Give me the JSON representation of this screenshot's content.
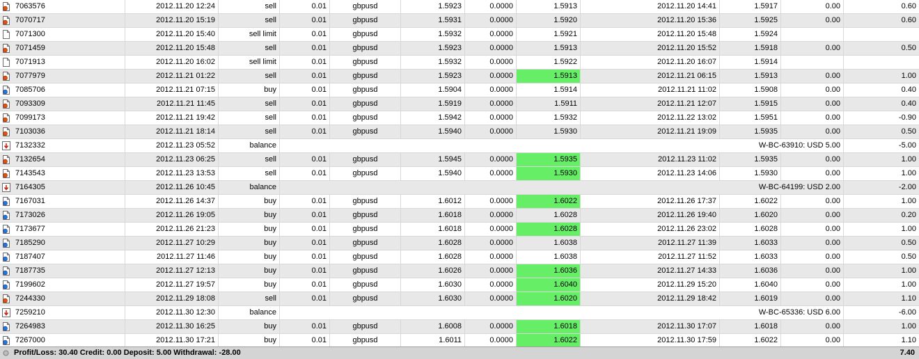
{
  "colors": {
    "highlight": "#66ee66",
    "sell_icon": "#e05010",
    "buy_icon": "#2a72d8",
    "balance_icon": "#c0281a"
  },
  "rows": [
    {
      "ticket": "7063576",
      "open_time": "2012.11.20 12:24",
      "type": "sell",
      "size": "0.01",
      "item": "gbpusd",
      "price": "1.5923",
      "sl": "0.0000",
      "tp": "1.5913",
      "close_time": "2012.11.20 14:41",
      "close_price": "1.5917",
      "swap": "0.00",
      "profit": "0.60",
      "kind": "sell",
      "hl": false
    },
    {
      "ticket": "7070717",
      "open_time": "2012.11.20 15:19",
      "type": "sell",
      "size": "0.01",
      "item": "gbpusd",
      "price": "1.5931",
      "sl": "0.0000",
      "tp": "1.5920",
      "close_time": "2012.11.20 15:36",
      "close_price": "1.5925",
      "swap": "0.00",
      "profit": "0.60",
      "kind": "sell",
      "hl": false
    },
    {
      "ticket": "7071300",
      "open_time": "2012.11.20 15:40",
      "type": "sell limit",
      "size": "0.01",
      "item": "gbpusd",
      "price": "1.5932",
      "sl": "0.0000",
      "tp": "1.5921",
      "close_time": "2012.11.20 15:48",
      "close_price": "1.5924",
      "swap": "",
      "profit": "",
      "kind": "doc",
      "hl": false
    },
    {
      "ticket": "7071459",
      "open_time": "2012.11.20 15:48",
      "type": "sell",
      "size": "0.01",
      "item": "gbpusd",
      "price": "1.5923",
      "sl": "0.0000",
      "tp": "1.5913",
      "close_time": "2012.11.20 15:52",
      "close_price": "1.5918",
      "swap": "0.00",
      "profit": "0.50",
      "kind": "sell",
      "hl": false
    },
    {
      "ticket": "7071913",
      "open_time": "2012.11.20 16:02",
      "type": "sell limit",
      "size": "0.01",
      "item": "gbpusd",
      "price": "1.5932",
      "sl": "0.0000",
      "tp": "1.5922",
      "close_time": "2012.11.20 16:07",
      "close_price": "1.5914",
      "swap": "",
      "profit": "",
      "kind": "doc",
      "hl": false
    },
    {
      "ticket": "7077979",
      "open_time": "2012.11.21 01:22",
      "type": "sell",
      "size": "0.01",
      "item": "gbpusd",
      "price": "1.5923",
      "sl": "0.0000",
      "tp": "1.5913",
      "close_time": "2012.11.21 06:15",
      "close_price": "1.5913",
      "swap": "0.00",
      "profit": "1.00",
      "kind": "sell",
      "hl": true
    },
    {
      "ticket": "7085706",
      "open_time": "2012.11.21 07:15",
      "type": "buy",
      "size": "0.01",
      "item": "gbpusd",
      "price": "1.5904",
      "sl": "0.0000",
      "tp": "1.5914",
      "close_time": "2012.11.21 11:02",
      "close_price": "1.5908",
      "swap": "0.00",
      "profit": "0.40",
      "kind": "buy",
      "hl": false
    },
    {
      "ticket": "7093309",
      "open_time": "2012.11.21 11:45",
      "type": "sell",
      "size": "0.01",
      "item": "gbpusd",
      "price": "1.5919",
      "sl": "0.0000",
      "tp": "1.5911",
      "close_time": "2012.11.21 12:07",
      "close_price": "1.5915",
      "swap": "0.00",
      "profit": "0.40",
      "kind": "sell",
      "hl": false
    },
    {
      "ticket": "7099173",
      "open_time": "2012.11.21 19:42",
      "type": "sell",
      "size": "0.01",
      "item": "gbpusd",
      "price": "1.5942",
      "sl": "0.0000",
      "tp": "1.5932",
      "close_time": "2012.11.22 13:02",
      "close_price": "1.5951",
      "swap": "0.00",
      "profit": "-0.90",
      "kind": "sell",
      "hl": false
    },
    {
      "ticket": "7103036",
      "open_time": "2012.11.21 18:14",
      "type": "sell",
      "size": "0.01",
      "item": "gbpusd",
      "price": "1.5940",
      "sl": "0.0000",
      "tp": "1.5930",
      "close_time": "2012.11.21 19:09",
      "close_price": "1.5935",
      "swap": "0.00",
      "profit": "0.50",
      "kind": "sell",
      "hl": false
    },
    {
      "ticket": "7132332",
      "open_time": "2012.11.23 05:52",
      "type": "balance",
      "comment": "W-BC-63910: USD 5.00",
      "profit": "-5.00",
      "kind": "balance"
    },
    {
      "ticket": "7132654",
      "open_time": "2012.11.23 06:25",
      "type": "sell",
      "size": "0.01",
      "item": "gbpusd",
      "price": "1.5945",
      "sl": "0.0000",
      "tp": "1.5935",
      "close_time": "2012.11.23 11:02",
      "close_price": "1.5935",
      "swap": "0.00",
      "profit": "1.00",
      "kind": "sell",
      "hl": true
    },
    {
      "ticket": "7143543",
      "open_time": "2012.11.23 13:53",
      "type": "sell",
      "size": "0.01",
      "item": "gbpusd",
      "price": "1.5940",
      "sl": "0.0000",
      "tp": "1.5930",
      "close_time": "2012.11.23 14:06",
      "close_price": "1.5930",
      "swap": "0.00",
      "profit": "1.00",
      "kind": "sell",
      "hl": true
    },
    {
      "ticket": "7164305",
      "open_time": "2012.11.26 10:45",
      "type": "balance",
      "comment": "W-BC-64199: USD 2.00",
      "profit": "-2.00",
      "kind": "balance"
    },
    {
      "ticket": "7167031",
      "open_time": "2012.11.26 14:37",
      "type": "buy",
      "size": "0.01",
      "item": "gbpusd",
      "price": "1.6012",
      "sl": "0.0000",
      "tp": "1.6022",
      "close_time": "2012.11.26 17:37",
      "close_price": "1.6022",
      "swap": "0.00",
      "profit": "1.00",
      "kind": "buy",
      "hl": true
    },
    {
      "ticket": "7173026",
      "open_time": "2012.11.26 19:05",
      "type": "buy",
      "size": "0.01",
      "item": "gbpusd",
      "price": "1.6018",
      "sl": "0.0000",
      "tp": "1.6028",
      "close_time": "2012.11.26 19:40",
      "close_price": "1.6020",
      "swap": "0.00",
      "profit": "0.20",
      "kind": "buy",
      "hl": false
    },
    {
      "ticket": "7173677",
      "open_time": "2012.11.26 21:23",
      "type": "buy",
      "size": "0.01",
      "item": "gbpusd",
      "price": "1.6018",
      "sl": "0.0000",
      "tp": "1.6028",
      "close_time": "2012.11.26 23:02",
      "close_price": "1.6028",
      "swap": "0.00",
      "profit": "1.00",
      "kind": "buy",
      "hl": true
    },
    {
      "ticket": "7185290",
      "open_time": "2012.11.27 10:29",
      "type": "buy",
      "size": "0.01",
      "item": "gbpusd",
      "price": "1.6028",
      "sl": "0.0000",
      "tp": "1.6038",
      "close_time": "2012.11.27 11:39",
      "close_price": "1.6033",
      "swap": "0.00",
      "profit": "0.50",
      "kind": "buy",
      "hl": false
    },
    {
      "ticket": "7187407",
      "open_time": "2012.11.27 11:46",
      "type": "buy",
      "size": "0.01",
      "item": "gbpusd",
      "price": "1.6028",
      "sl": "0.0000",
      "tp": "1.6038",
      "close_time": "2012.11.27 11:52",
      "close_price": "1.6033",
      "swap": "0.00",
      "profit": "0.50",
      "kind": "buy",
      "hl": false
    },
    {
      "ticket": "7187735",
      "open_time": "2012.11.27 12:13",
      "type": "buy",
      "size": "0.01",
      "item": "gbpusd",
      "price": "1.6026",
      "sl": "0.0000",
      "tp": "1.6036",
      "close_time": "2012.11.27 14:33",
      "close_price": "1.6036",
      "swap": "0.00",
      "profit": "1.00",
      "kind": "buy",
      "hl": true
    },
    {
      "ticket": "7199602",
      "open_time": "2012.11.27 19:57",
      "type": "buy",
      "size": "0.01",
      "item": "gbpusd",
      "price": "1.6030",
      "sl": "0.0000",
      "tp": "1.6040",
      "close_time": "2012.11.29 15:20",
      "close_price": "1.6040",
      "swap": "0.00",
      "profit": "1.00",
      "kind": "buy",
      "hl": true
    },
    {
      "ticket": "7244330",
      "open_time": "2012.11.29 18:08",
      "type": "sell",
      "size": "0.01",
      "item": "gbpusd",
      "price": "1.6030",
      "sl": "0.0000",
      "tp": "1.6020",
      "close_time": "2012.11.29 18:42",
      "close_price": "1.6019",
      "swap": "0.00",
      "profit": "1.10",
      "kind": "sell",
      "hl": true
    },
    {
      "ticket": "7259210",
      "open_time": "2012.11.30 12:30",
      "type": "balance",
      "comment": "W-BC-65336: USD 6.00",
      "profit": "-6.00",
      "kind": "balance"
    },
    {
      "ticket": "7264983",
      "open_time": "2012.11.30 16:25",
      "type": "buy",
      "size": "0.01",
      "item": "gbpusd",
      "price": "1.6008",
      "sl": "0.0000",
      "tp": "1.6018",
      "close_time": "2012.11.30 17:07",
      "close_price": "1.6018",
      "swap": "0.00",
      "profit": "1.00",
      "kind": "buy",
      "hl": true
    },
    {
      "ticket": "7267000",
      "open_time": "2012.11.30 17:21",
      "type": "buy",
      "size": "0.01",
      "item": "gbpusd",
      "price": "1.6011",
      "sl": "0.0000",
      "tp": "1.6022",
      "close_time": "2012.11.30 17:59",
      "close_price": "1.6022",
      "swap": "0.00",
      "profit": "1.10",
      "kind": "buy",
      "hl": true
    }
  ],
  "status": {
    "summary": "Profit/Loss: 30.40  Credit: 0.00  Deposit: 5.00  Withdrawal: -28.00",
    "total": "7.40"
  }
}
